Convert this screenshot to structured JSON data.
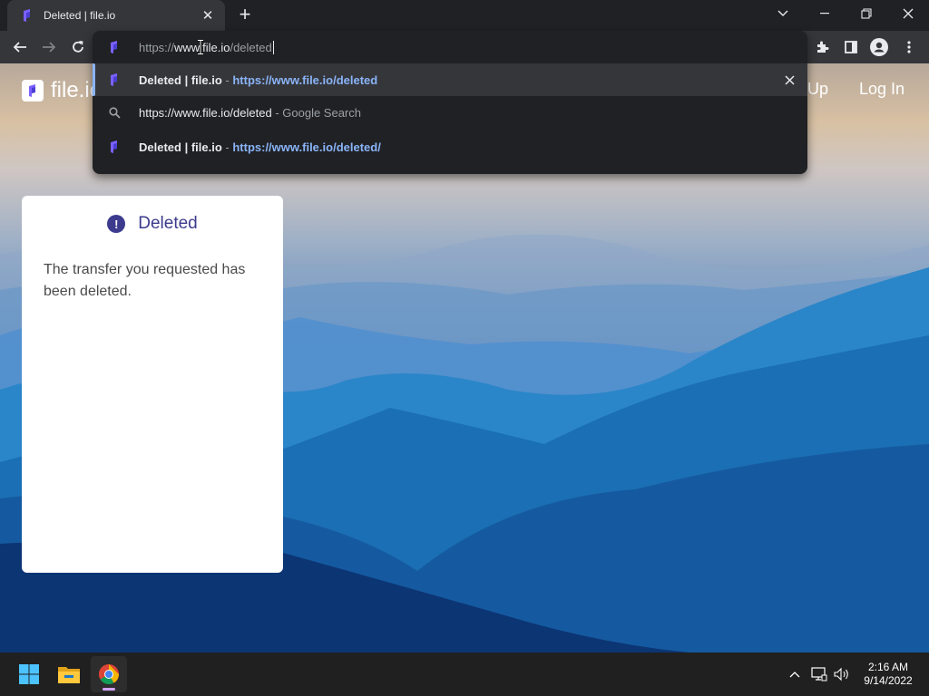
{
  "browser": {
    "tab_title": "Deleted | file.io",
    "omnibox": {
      "url_prefix": "https://",
      "url_host": "www.file.io",
      "url_path": "/deleted"
    },
    "suggestions": [
      {
        "title": "Deleted | file.io",
        "separator": " - ",
        "url": "https://www.file.io/deleted",
        "icon": "fileio-favicon",
        "selected": true
      },
      {
        "title": "https://www.file.io/deleted",
        "separator": " - ",
        "detail": "Google Search",
        "icon": "search-icon",
        "selected": false
      },
      {
        "title": "Deleted | file.io",
        "separator": " - ",
        "url": "https://www.file.io/deleted/",
        "icon": "fileio-favicon",
        "selected": false
      }
    ]
  },
  "site": {
    "logo_text": "file.io",
    "nav_signup": "Up",
    "nav_login": "Log In"
  },
  "card": {
    "alert_glyph": "!",
    "title": "Deleted",
    "message": "The transfer you requested has been deleted."
  },
  "taskbar": {
    "time": "2:16 AM",
    "date": "9/14/2022"
  },
  "colors": {
    "accent": "#3c3b8e",
    "link": "#8ab4f8"
  }
}
